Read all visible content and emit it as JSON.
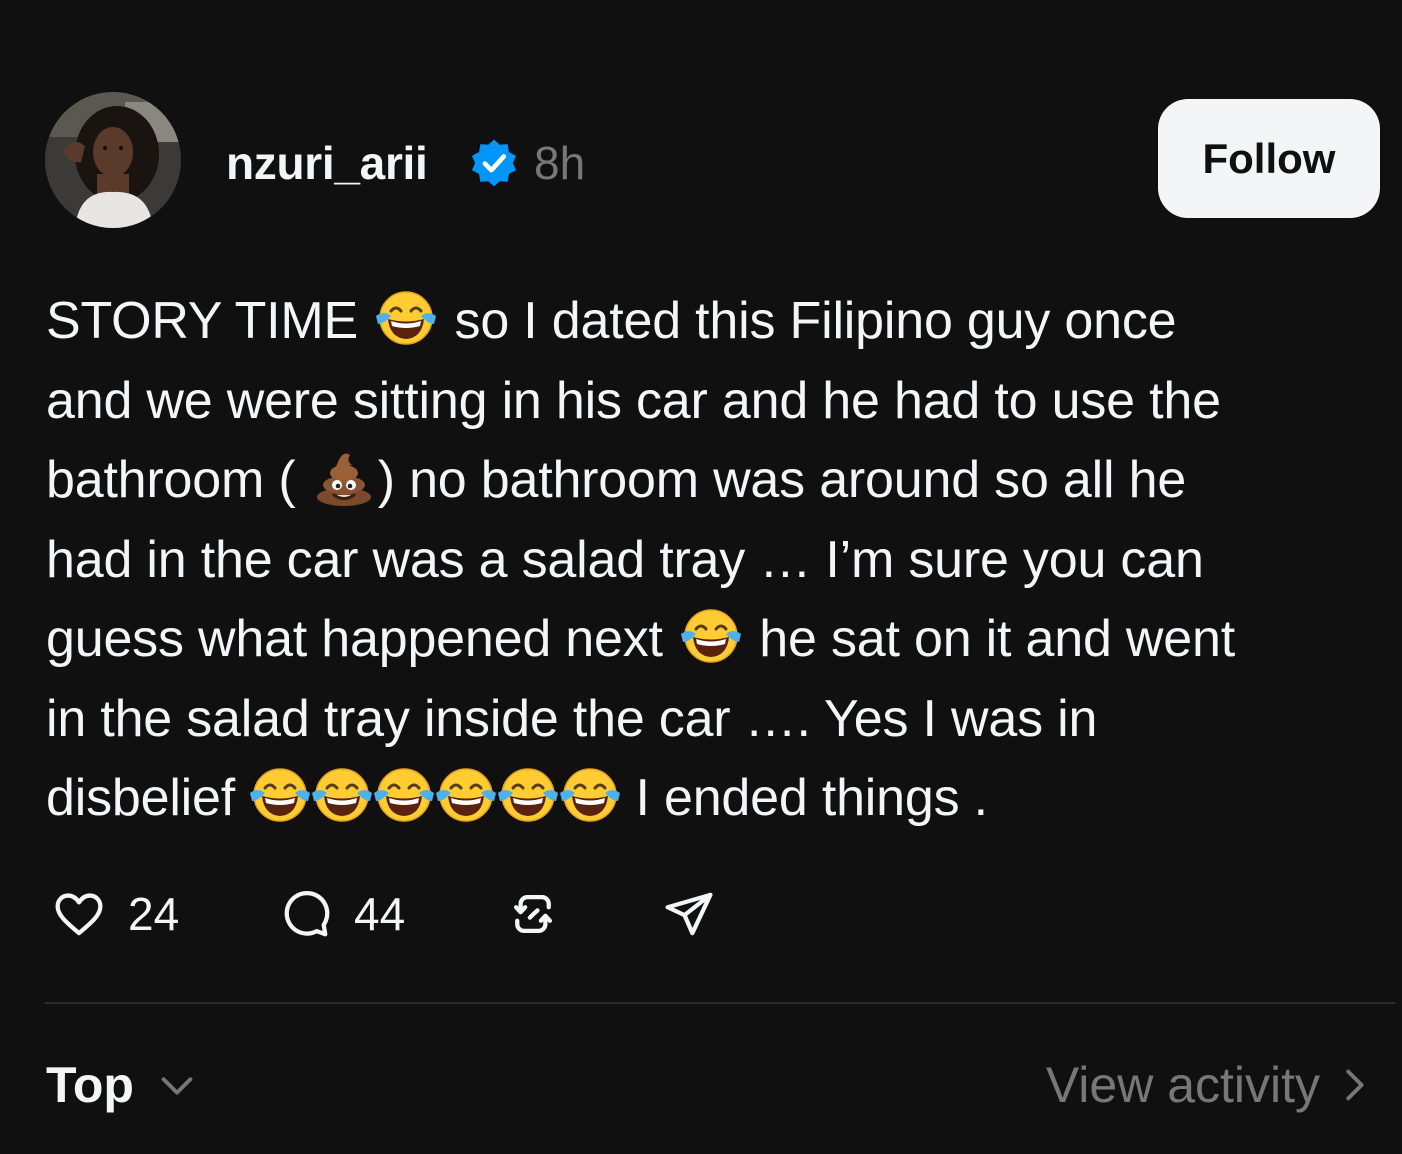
{
  "post": {
    "author": {
      "username": "nzuri_arii",
      "verified": true,
      "avatar_icon": "profile-photo"
    },
    "timestamp": "8h",
    "follow_label": "Follow",
    "text_lines": [
      [
        "STORY TIME ",
        {
          "emoji": "face-with-tears-of-joy"
        },
        " so I dated this Filipino guy once"
      ],
      [
        "and we were sitting in his car and he had to use the"
      ],
      [
        "bathroom ( ",
        {
          "emoji": "pile-of-poo"
        },
        ") no bathroom was around so all he"
      ],
      [
        "had in the car was a salad tray … I’m sure you can"
      ],
      [
        "guess what happened next ",
        {
          "emoji": "face-with-tears-of-joy"
        },
        " he sat on it and went"
      ],
      [
        "in the salad tray inside the car …. Yes I was in"
      ],
      [
        "disbelief ",
        {
          "emoji": "face-with-tears-of-joy"
        },
        {
          "emoji": "face-with-tears-of-joy"
        },
        {
          "emoji": "face-with-tears-of-joy"
        },
        {
          "emoji": "face-with-tears-of-joy"
        },
        {
          "emoji": "face-with-tears-of-joy"
        },
        {
          "emoji": "face-with-tears-of-joy"
        },
        " I ended things ."
      ]
    ],
    "actions": {
      "like": {
        "icon": "heart-icon",
        "count": "24"
      },
      "reply": {
        "icon": "comment-icon",
        "count": "44"
      },
      "repost": {
        "icon": "repost-icon"
      },
      "share": {
        "icon": "send-icon"
      }
    }
  },
  "replies_bar": {
    "sort_label": "Top",
    "sort_icon": "chevron-down-icon",
    "view_activity_label": "View activity",
    "view_activity_icon": "chevron-right-icon"
  },
  "colors": {
    "background": "#101010",
    "text_primary": "#f3f5f7",
    "text_secondary": "#777777",
    "verified_blue": "#0095f6",
    "follow_button_bg": "#f3f5f7",
    "divider": "#2a2a2a"
  }
}
